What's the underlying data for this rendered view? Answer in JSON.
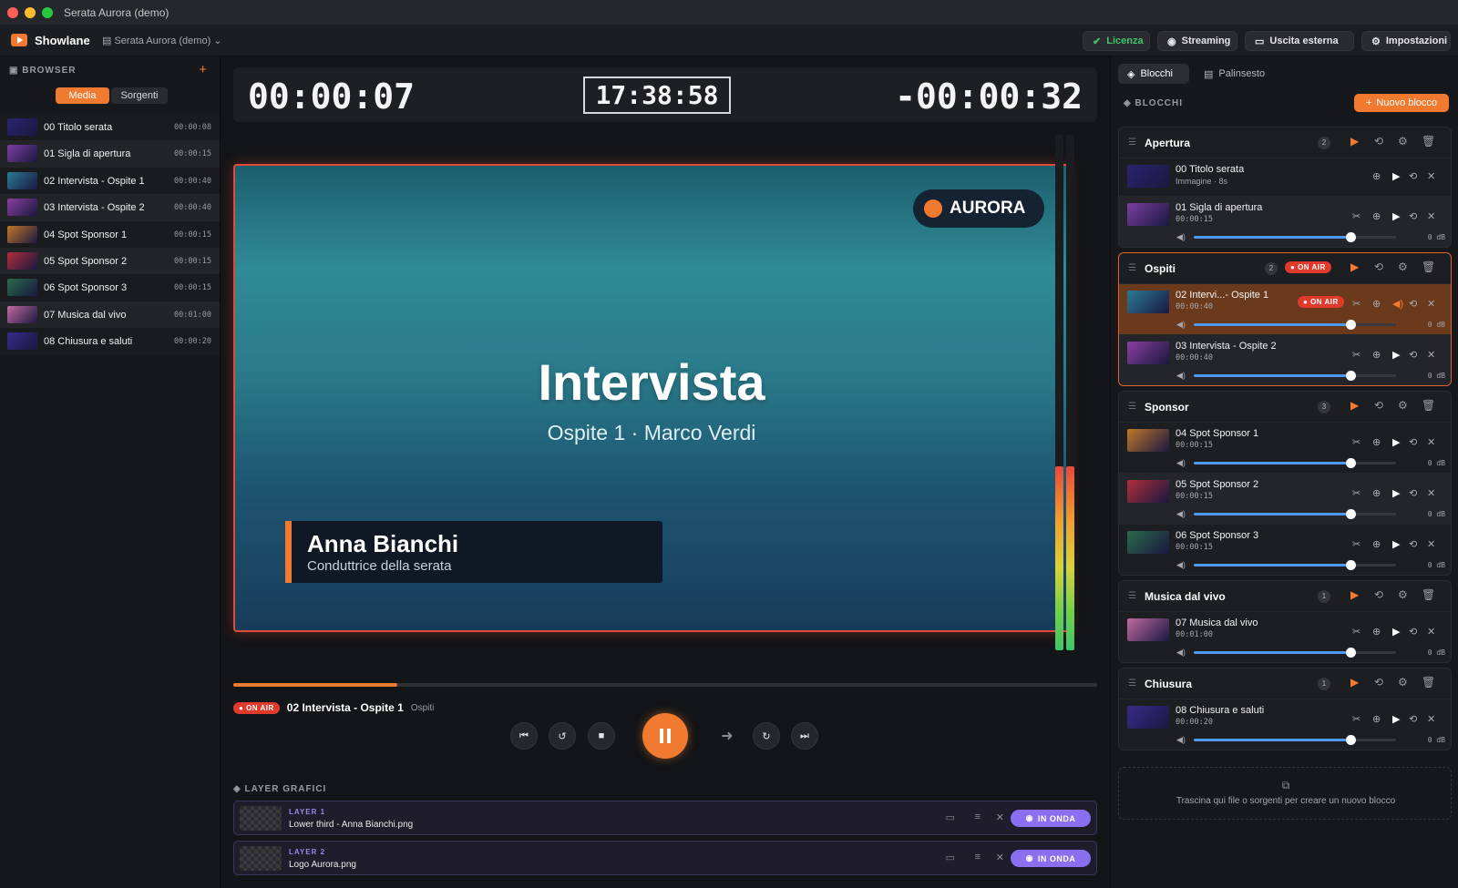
{
  "window": {
    "title": "Serata Aurora (demo)"
  },
  "appbar": {
    "app_name": "Showlane",
    "project": "Serata Aurora (demo)",
    "license": "Licenza",
    "streaming": "Streaming",
    "external": "Uscita esterna",
    "settings": "Impostazioni"
  },
  "browser": {
    "header": "BROWSER",
    "tab_media": "Media",
    "tab_sources": "Sorgenti",
    "items": [
      {
        "name": "00 Titolo serata",
        "duration": "00:00:08",
        "color": "#2a2470"
      },
      {
        "name": "01 Sigla di apertura",
        "duration": "00:00:15",
        "color": "#7a3fa0"
      },
      {
        "name": "02 Intervista - Ospite 1",
        "duration": "00:00:40",
        "color": "#2a7a94"
      },
      {
        "name": "03 Intervista - Ospite 2",
        "duration": "00:00:40",
        "color": "#8a3fa0"
      },
      {
        "name": "04 Spot Sponsor 1",
        "duration": "00:00:15",
        "color": "#c0762a"
      },
      {
        "name": "05 Spot Sponsor 2",
        "duration": "00:00:15",
        "color": "#b02e3a"
      },
      {
        "name": "06 Spot Sponsor 3",
        "duration": "00:00:15",
        "color": "#2a6a4a"
      },
      {
        "name": "07 Musica dal vivo",
        "duration": "00:01:00",
        "color": "#c06aa0"
      },
      {
        "name": "08 Chiusura e saluti",
        "duration": "00:00:20",
        "color": "#3a2a8a"
      }
    ]
  },
  "clocks": {
    "elapsed": "00:00:07",
    "time": "17:38:58",
    "remaining": "-00:00:32"
  },
  "preview": {
    "badge": "AURORA",
    "title": "Intervista",
    "subtitle": "Ospite 1 · Marco Verdi",
    "lower_name": "Anna Bianchi",
    "lower_role": "Conduttrice della serata"
  },
  "playback": {
    "progress_percent": 19,
    "on_air": "ON AIR",
    "now_title": "02 Intervista - Ospite 1",
    "now_group": "Ospiti"
  },
  "layers": {
    "header": "LAYER GRAFICI",
    "items": [
      {
        "label": "LAYER 1",
        "file": "Lower third - Anna Bianchi.png",
        "status": "IN ONDA"
      },
      {
        "label": "LAYER 2",
        "file": "Logo Aurora.png",
        "status": "IN ONDA"
      }
    ]
  },
  "right": {
    "tab_blocks": "Blocchi",
    "tab_schedule": "Palinsesto",
    "header": "BLOCCHI",
    "new_block": "Nuovo blocco",
    "drop_text": "Trascina qui file o sorgenti per creare un nuovo blocco",
    "groups": [
      {
        "name": "Apertura",
        "count": "2",
        "items": [
          {
            "name": "00 Titolo serata",
            "meta": "Immagine · 8s",
            "color": "#2a2470"
          },
          {
            "name": "01 Sigla di apertura",
            "meta": "00:00:15",
            "vol": "0 dB",
            "color": "#7a3fa0"
          }
        ]
      },
      {
        "name": "Ospiti",
        "count": "2",
        "on_air": "ON AIR",
        "items": [
          {
            "name": "02 Intervi...- Ospite 1",
            "meta": "00:00:40",
            "vol": "0 dB",
            "on_air": "ON AIR",
            "color": "#2a7a94"
          },
          {
            "name": "03 Intervista - Ospite 2",
            "meta": "00:00:40",
            "vol": "0 dB",
            "color": "#8a3fa0"
          }
        ]
      },
      {
        "name": "Sponsor",
        "count": "3",
        "items": [
          {
            "name": "04 Spot Sponsor 1",
            "meta": "00:00:15",
            "vol": "0 dB",
            "color": "#c0762a"
          },
          {
            "name": "05 Spot Sponsor 2",
            "meta": "00:00:15",
            "vol": "0 dB",
            "color": "#b02e3a"
          },
          {
            "name": "06 Spot Sponsor 3",
            "meta": "00:00:15",
            "vol": "0 dB",
            "color": "#2a6a4a"
          }
        ]
      },
      {
        "name": "Musica dal vivo",
        "count": "1",
        "items": [
          {
            "name": "07 Musica dal vivo",
            "meta": "00:01:00",
            "vol": "0 dB",
            "color": "#c06aa0"
          }
        ]
      },
      {
        "name": "Chiusura",
        "count": "1",
        "items": [
          {
            "name": "08 Chiusura e saluti",
            "meta": "00:00:20",
            "vol": "0 dB",
            "color": "#3a2a8a"
          }
        ]
      }
    ]
  }
}
